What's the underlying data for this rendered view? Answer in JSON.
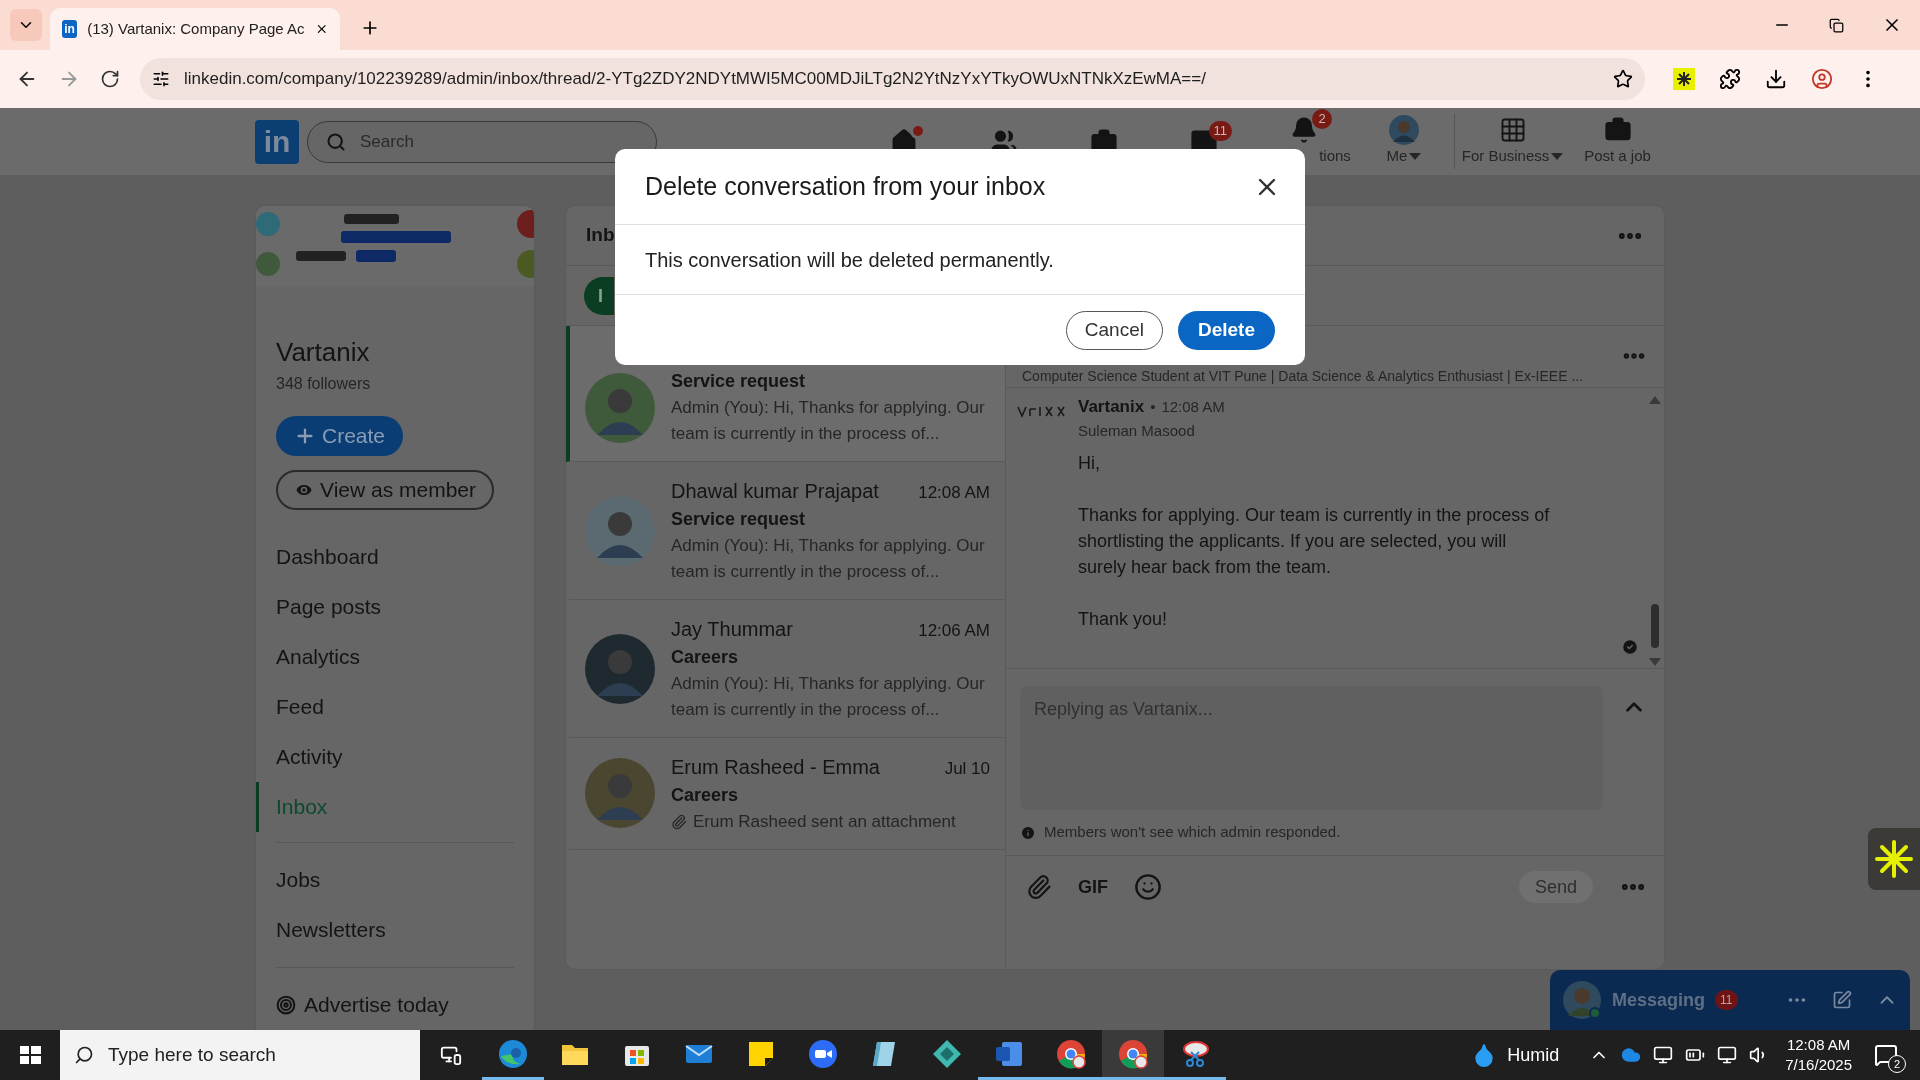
{
  "browser": {
    "tab_title": "(13) Vartanix: Company Page Ac",
    "favicon": "in",
    "url": "linkedin.com/company/102239289/admin/inbox/thread/2-YTg2ZDY2NDYtMWI5MC00MDJiLTg2N2YtNzYxYTkyOWUxNTNkXzEwMA==/"
  },
  "navbar": {
    "logo": "in",
    "search_placeholder": "Search",
    "items": [
      {
        "kind": "home",
        "dot": true
      },
      {
        "kind": "network"
      },
      {
        "kind": "jobs"
      },
      {
        "kind": "messaging",
        "badge": "11"
      },
      {
        "kind": "notifications",
        "badge": "2",
        "label": "tions"
      },
      {
        "kind": "me",
        "label": "Me",
        "dropdown": true
      },
      {
        "kind": "business",
        "label": "For Business",
        "dropdown": true
      },
      {
        "kind": "post_job",
        "label": "Post a job"
      }
    ]
  },
  "sidebar": {
    "name": "Vartanix",
    "followers": "348 followers",
    "create_button": "Create",
    "view_button": "View as member",
    "groups": [
      {
        "items": [
          {
            "label": "Dashboard",
            "selected": false
          },
          {
            "label": "Page posts",
            "selected": false
          },
          {
            "label": "Analytics",
            "selected": false
          },
          {
            "label": "Feed",
            "selected": false
          },
          {
            "label": "Activity",
            "selected": false
          },
          {
            "label": "Inbox",
            "selected": true
          }
        ]
      },
      {
        "items": [
          {
            "label": "Jobs",
            "selected": false
          },
          {
            "label": "Newsletters",
            "selected": false
          }
        ]
      },
      {
        "items": [
          {
            "label": "Advertise today",
            "selected": false,
            "kind": "promo"
          }
        ]
      }
    ]
  },
  "inbox": {
    "title": "Inb",
    "filter": {
      "label": "I",
      "selected": true
    },
    "conversations": [
      {
        "subject": "Service request",
        "preview": "Admin (You): Hi, Thanks for applying. Our team is currently in the process of...",
        "kind": "message",
        "selected": true
      },
      {
        "name": "Dhawal kumar Prajapat",
        "time": "12:08 AM",
        "subject": "Service request",
        "preview": "Admin (You): Hi, Thanks for applying. Our team is currently in the process of...",
        "kind": "message",
        "selected": false
      },
      {
        "name": "Jay Thummar",
        "time": "12:06 AM",
        "subject": "Careers",
        "preview": "Admin (You): Hi, Thanks for applying. Our team is currently in the process of...",
        "kind": "message",
        "selected": false
      },
      {
        "name": "Erum Rasheed - Emma",
        "time": "Jul 10",
        "subject": "Careers",
        "preview": "Erum Rasheed sent an attachment",
        "kind": "attachment",
        "selected": false
      }
    ]
  },
  "thread": {
    "headline": "Computer Science Student at VIT Pune | Data Science & Analytics Enthusiast | Ex-IEEE ...",
    "message": {
      "sender": "Vartanix",
      "separator": "•",
      "time": "12:08 AM",
      "admin": "Suleman Masood",
      "paragraphs": [
        "Hi,",
        "Thanks for applying. Our team is currently in the process of shortlisting the applicants. If you are selected, you will surely hear back from the team.",
        "Thank you!"
      ],
      "read": true
    },
    "reply_placeholder": "Replying as Vartanix...",
    "note": "Members won't see which admin responded.",
    "gif": "GIF",
    "send": {
      "label": "Send",
      "disabled": true
    }
  },
  "messaging_widget": {
    "title": "Messaging",
    "badge": "11"
  },
  "modal": {
    "title": "Delete conversation from your inbox",
    "body": "This conversation will be deleted permanently.",
    "cancel": "Cancel",
    "confirm": "Delete"
  },
  "taskbar": {
    "search_placeholder": "Type here to search",
    "apps": [
      {
        "kind": "edge",
        "running": true,
        "selected": false
      },
      {
        "kind": "explorer",
        "running": false,
        "selected": false
      },
      {
        "kind": "store",
        "running": false,
        "selected": false
      },
      {
        "kind": "mail",
        "running": false,
        "selected": false
      },
      {
        "kind": "sticky",
        "running": false,
        "selected": false
      },
      {
        "kind": "zoom",
        "running": false,
        "selected": false
      },
      {
        "kind": "book",
        "running": false,
        "selected": false
      },
      {
        "kind": "diamond",
        "running": false,
        "selected": false
      },
      {
        "kind": "word",
        "running": true,
        "selected": false
      },
      {
        "kind": "chrome",
        "running": true,
        "selected": false
      },
      {
        "kind": "chrome",
        "running": true,
        "selected": true
      },
      {
        "kind": "snip",
        "running": true,
        "selected": false
      }
    ],
    "weather": "Humid",
    "time": "12:08 AM",
    "date": "7/16/2025",
    "notifications": "2"
  }
}
